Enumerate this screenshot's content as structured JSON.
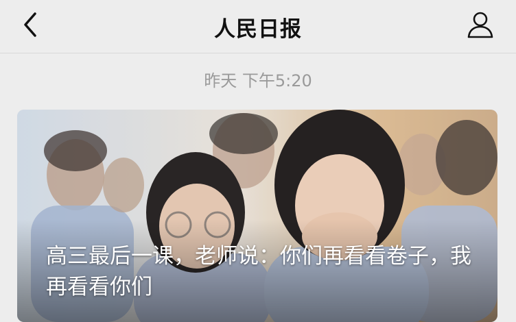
{
  "header": {
    "title": "人民日报",
    "back_icon": "chevron-left-icon",
    "profile_icon": "user-icon"
  },
  "message": {
    "timestamp": "昨天 下午5:20",
    "article": {
      "headline": "高三最后一课，老师说：你们再看看卷子，我再看看你们"
    }
  },
  "colors": {
    "background": "#ededed",
    "title": "#111111",
    "timestamp": "#9a9a9a"
  }
}
